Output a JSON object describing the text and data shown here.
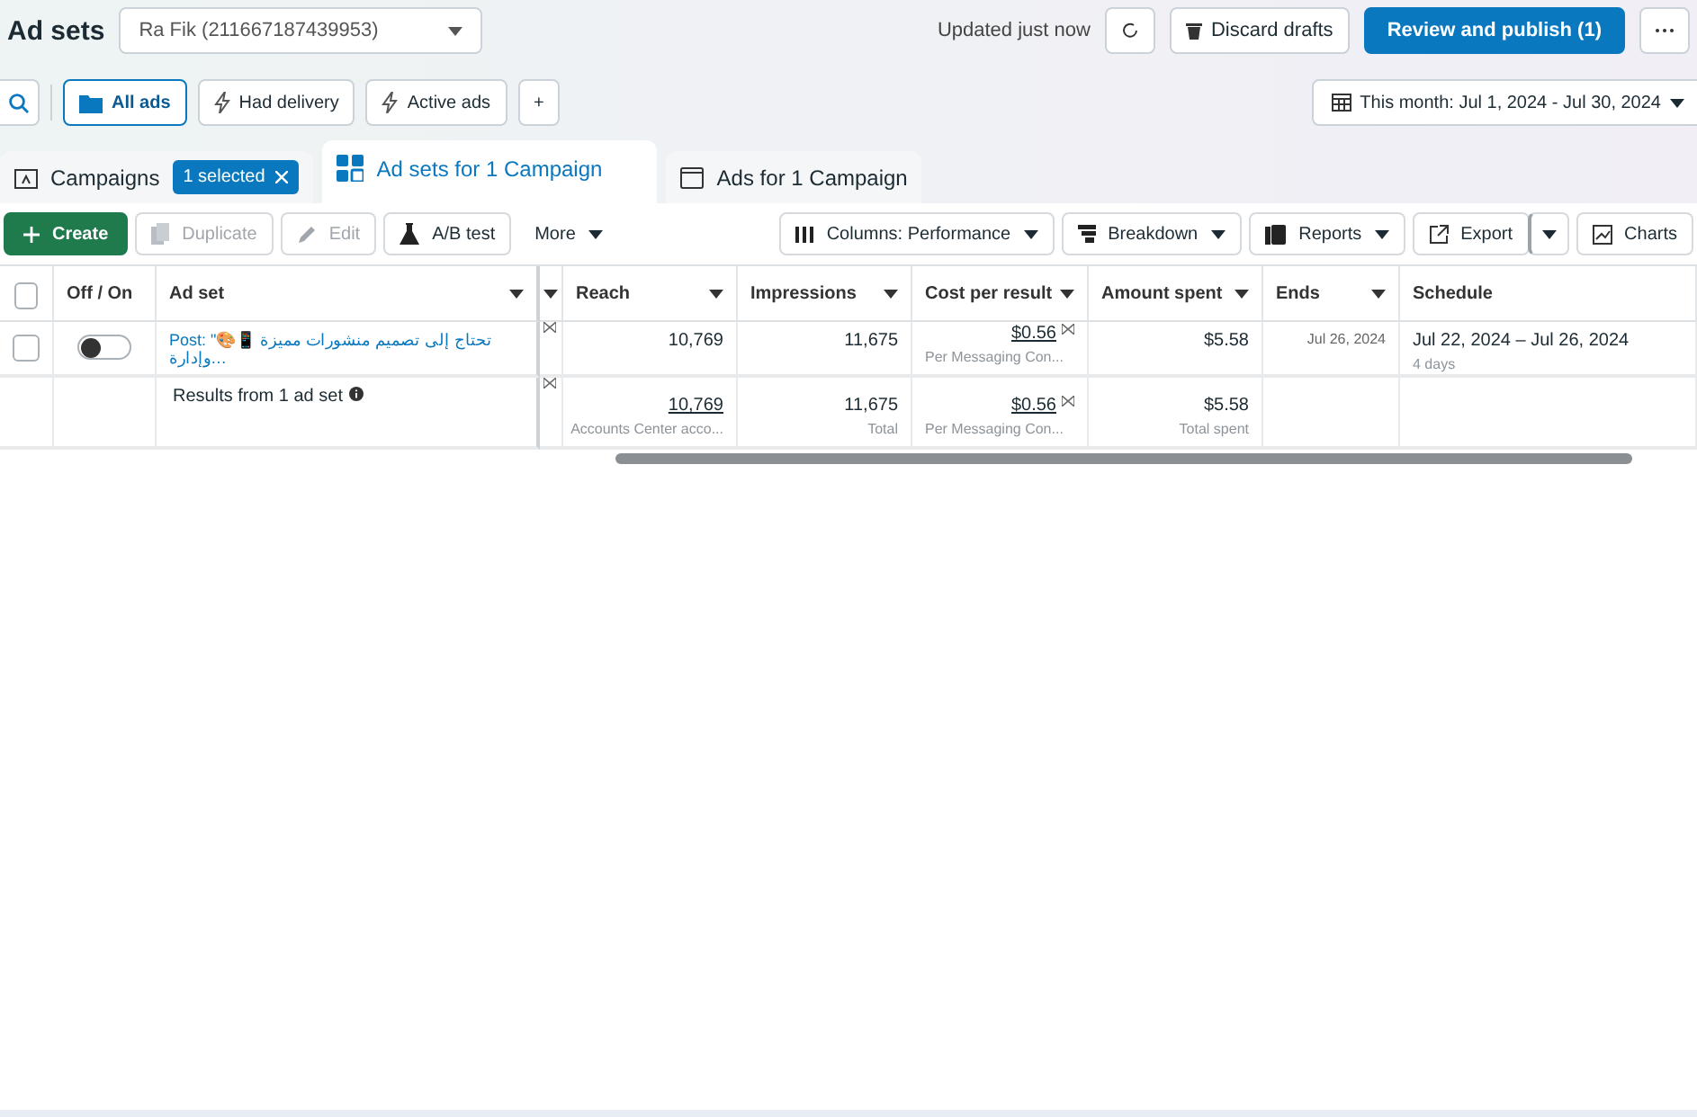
{
  "header": {
    "title": "Ad sets",
    "account": "Ra Fik (211667187439953)",
    "status": "Updated just now",
    "discard": "Discard drafts",
    "publish": "Review and publish (1)"
  },
  "filters": {
    "items": [
      {
        "label": "All ads",
        "selected": true,
        "kind": "folder"
      },
      {
        "label": "Had delivery",
        "selected": false,
        "kind": "bolt"
      },
      {
        "label": "Active ads",
        "selected": false,
        "kind": "bolt"
      }
    ],
    "add": "+",
    "date_range": "This month: Jul 1, 2024 - Jul 30, 2024"
  },
  "tabs": [
    {
      "label": "Campaigns",
      "selected": false,
      "kind": "campaign",
      "badge": "1 selected"
    },
    {
      "label": "Ad sets for 1 Campaign",
      "selected": true,
      "kind": "adset"
    },
    {
      "label": "Ads for 1 Campaign",
      "selected": false,
      "kind": "ad"
    }
  ],
  "toolbar": [
    {
      "label": "Create",
      "kind": "create",
      "disabled": false,
      "dropdown": false
    },
    {
      "label": "Duplicate",
      "kind": "duplicate",
      "disabled": true,
      "dropdown": false
    },
    {
      "label": "Edit",
      "kind": "edit",
      "disabled": true,
      "dropdown": false
    },
    {
      "label": "A/B test",
      "kind": "abtest",
      "disabled": false,
      "dropdown": false
    },
    {
      "label": "More",
      "kind": "more",
      "disabled": false,
      "dropdown": true
    },
    {
      "label": "Columns: Performance",
      "kind": "columns",
      "disabled": false,
      "dropdown": true
    },
    {
      "label": "Breakdown",
      "kind": "breakdown",
      "disabled": false,
      "dropdown": true
    },
    {
      "label": "Reports",
      "kind": "reports",
      "disabled": false,
      "dropdown": true
    },
    {
      "label": "Export",
      "kind": "export",
      "disabled": false,
      "dropdown": false
    },
    {
      "kind": "split",
      "disabled": false,
      "dropdown": true
    },
    {
      "label": "Charts",
      "kind": "charts",
      "disabled": false,
      "dropdown": false
    }
  ],
  "table": {
    "header_checked": false,
    "columns": [
      {
        "label": "Off / On",
        "sortable": false
      },
      {
        "label": "Ad set",
        "sortable": true
      },
      {
        "sortable": true
      },
      {
        "label": "Reach",
        "sortable": true
      },
      {
        "label": "Impressions",
        "sortable": true
      },
      {
        "label": "Cost per result",
        "sortable": true
      },
      {
        "label": "Amount spent",
        "sortable": true
      },
      {
        "label": "Ends",
        "sortable": true
      },
      {
        "label": "Schedule",
        "sortable": false
      }
    ],
    "rows": [
      {
        "checked": false,
        "on": false,
        "name": "Post: \"🎨📱 تحتاج إلى تصميم منشورات مميزة وإدارة…",
        "reach": "10,769",
        "impressions": "11,675",
        "cost": "$0.56",
        "cost_note": "Per Messaging Con...",
        "amount": "$5.58",
        "ends": "Jul 26, 2024",
        "schedule": "Jul 22, 2024 – Jul 26, 2024",
        "schedule_note": "4 days"
      }
    ],
    "summary": {
      "label": "Results from 1 ad set",
      "reach": "10,769",
      "reach_note": "Accounts Center acco...",
      "impressions": "11,675",
      "impressions_note": "Total",
      "cost": "$0.56",
      "cost_note": "Per Messaging Con...",
      "amount": "$5.58",
      "amount_note": "Total spent"
    }
  }
}
